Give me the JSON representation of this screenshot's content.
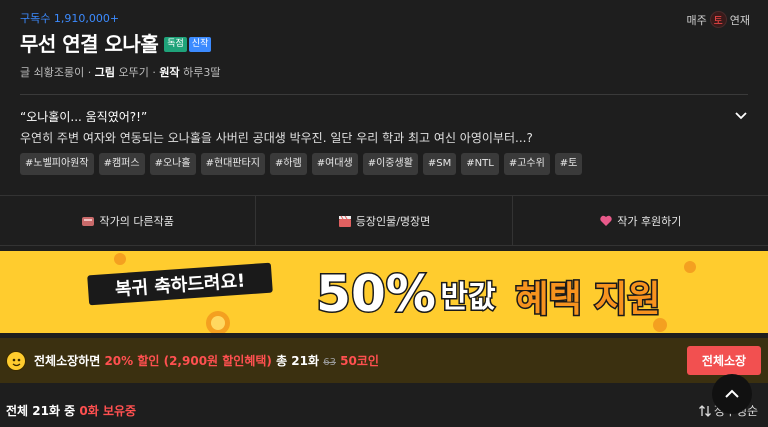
{
  "header": {
    "subscribers": "구독수 1,910,000+",
    "weekly_prefix": "매주",
    "day": "토",
    "weekly_suffix": "연재",
    "title": "무선 연결 오나홀",
    "badge_exclusive": "독점",
    "badge_new": "신작",
    "credits": {
      "writer_label": "글",
      "writer": "쇠황조롱이",
      "artist_label": "그림",
      "artist": "오뚜기",
      "original_label": "원작",
      "original": "하루3딸"
    }
  },
  "description": {
    "headline": "“오나홀이... 움직였어?!”",
    "body": "우연히 주변 여자와 연동되는 오나홀을 사버린 공대생 박우진. 일단 우리 학과 최고 여신 아영이부터...?"
  },
  "tags": [
    "#노벨피아원작",
    "#캠퍼스",
    "#오나홀",
    "#현대판타지",
    "#하렘",
    "#여대생",
    "#이중생활",
    "#SM",
    "#NTL",
    "#고수위",
    "#토"
  ],
  "menu": [
    {
      "label": "작가의 다른작품",
      "icon": "book-stack-icon"
    },
    {
      "label": "등장인물/명장면",
      "icon": "clapperboard-icon"
    },
    {
      "label": "작가 후원하기",
      "icon": "heart-gift-icon"
    }
  ],
  "banner": {
    "left_text": "복귀 축하드려요!",
    "percent": "50%",
    "half_price": "반값",
    "benefit": "혜택 지원"
  },
  "buybar": {
    "prefix": "전체소장하면",
    "discount": "20% 할인 (2,900원 할인혜택)",
    "total": "총 21화",
    "original_price": "63",
    "price": "50코인",
    "button": "전체소장"
  },
  "footer": {
    "total_prefix": "전체 21화 중",
    "owned": "0화 보유중",
    "sort_label": "정주행순"
  },
  "colors": {
    "background": "#1e1e1e",
    "accent_blue": "#3c8bff",
    "accent_red": "#f25050",
    "banner_yellow": "#ffcc2e"
  }
}
